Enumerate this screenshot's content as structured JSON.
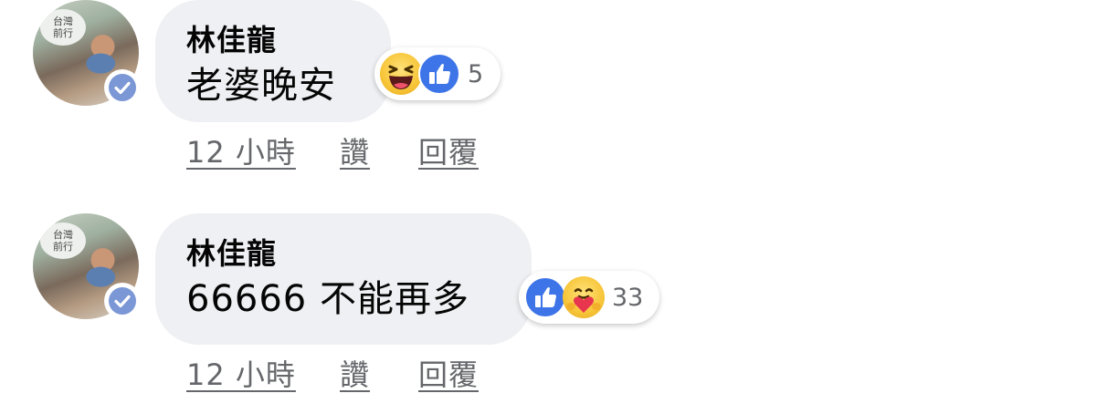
{
  "comments": [
    {
      "author": "林佳龍",
      "text": "老婆晚安",
      "avatar_sign": "台灣\n前行",
      "reactions": [
        "haha",
        "like"
      ],
      "reaction_count": "5",
      "time": "12 小時",
      "like_label": "讚",
      "reply_label": "回覆"
    },
    {
      "author": "林佳龍",
      "text": "66666 不能再多",
      "avatar_sign": "台灣\n前行",
      "reactions": [
        "like",
        "care"
      ],
      "reaction_count": "33",
      "time": "12 小時",
      "like_label": "讚",
      "reply_label": "回覆"
    }
  ],
  "colors": {
    "bubble": "#eff0f3",
    "meta": "#65676b",
    "like_blue": "#3d74e8",
    "verified": "#7b97d6"
  }
}
